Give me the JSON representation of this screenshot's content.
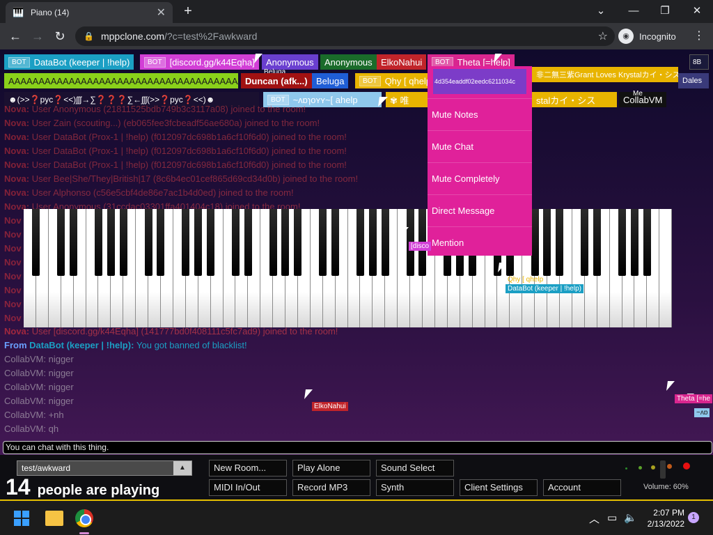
{
  "browser": {
    "tab_title": "Piano (14)",
    "tab_favicon": "piano-icon",
    "url_host": "mppclone.com",
    "url_path": "/?c=test%2Fawkward",
    "incognito_label": "Incognito"
  },
  "users_row1": [
    {
      "label": "DataBot (keeper | !help)",
      "bot": true,
      "color": "#1b9fc4"
    },
    {
      "label": "[discord.gg/k44Eqha]",
      "bot": true,
      "color": "#d23fd6"
    },
    {
      "label": "Anonymous",
      "bot": false,
      "color": "#6a3fd0"
    },
    {
      "label": "Anonymous",
      "bot": false,
      "color": "#1a6b2a"
    },
    {
      "label": "ElkoNahui",
      "bot": false,
      "color": "#c1242a"
    },
    {
      "label": "Theta [=help]",
      "bot": true,
      "color": "#d9268f"
    }
  ],
  "users_row2": [
    {
      "label": "AAAAAAAAAAAAAAAAAAAAAAAAAAAAAAAAAAAAAAAAAAA",
      "bot": false,
      "color": "#8ad11a"
    },
    {
      "label": "Duncan (afk...)",
      "bot": false,
      "color": "#a11212"
    },
    {
      "label": "Beluga",
      "bot": false,
      "color": "#1f5ed6"
    },
    {
      "label": "Qhy [ qhelp",
      "bot": true,
      "color": "#e8b400"
    },
    {
      "label": "非二無三紫Grant Loves Krystalカイ・シス",
      "bot": false,
      "color": "#e8b400"
    },
    {
      "label": "Dales",
      "bot": false,
      "color": "#3a3a7a"
    }
  ],
  "users_row3": [
    {
      "label": "☻(>>❓pyc❓<<)ʃʃʃ→∑❓❓❓∑←ʃʃʃ(>>❓pyc❓<<)☻",
      "bot": false,
      "color": "#1a1030"
    },
    {
      "label": "~ʌɒɿoʏʏ~[ ahelp",
      "bot": true,
      "color": "#8fc8ec"
    },
    {
      "label": "stalカイ・シス",
      "bot": false,
      "color": "#e8b400"
    },
    {
      "label": "CollabVM",
      "bot": false,
      "color": "#111"
    }
  ],
  "small_tags": {
    "beluga": "Beluga",
    "me": "Me",
    "corner": "8B"
  },
  "chat_system": [
    {
      "who": "Nova:",
      "msg": "User Anonymous (21811525bdb749b3c3117a08) joined to the room!"
    },
    {
      "who": "Nova:",
      "msg": "User Zain (scouting...) (eb065fee3fcbeadf56ae680a) joined to the room!"
    },
    {
      "who": "Nova:",
      "msg": "User DataBot (Prox-1 | !help) (f012097dc698b1a6cf10f6d0) joined to the room!"
    },
    {
      "who": "Nova:",
      "msg": "User DataBot (Prox-1 | !help) (f012097dc698b1a6cf10f6d0) joined to the room!"
    },
    {
      "who": "Nova:",
      "msg": "User DataBot (Prox-1 | !help) (f012097dc698b1a6cf10f6d0) joined to the room!"
    },
    {
      "who": "Nova:",
      "msg": "User Bee|She/They|British|17 (8c6b4ec01cef865d69cd34d0b) joined to the room!"
    },
    {
      "who": "Nova:",
      "msg": "User Alphonso (c56e5cbf4de86e7ac1b4d0ed) joined to the room!"
    },
    {
      "who": "Nova:",
      "msg": "User Anonymous (31ccdac03301ffa401404c18) joined to the room!"
    },
    {
      "who": "Nov",
      "msg": ""
    },
    {
      "who": "Nov",
      "msg": ""
    },
    {
      "who": "Nov",
      "msg": ""
    },
    {
      "who": "Nov",
      "msg": ""
    },
    {
      "who": "Nov",
      "msg": ""
    },
    {
      "who": "Nov",
      "msg": ""
    },
    {
      "who": "Nov",
      "msg": ""
    },
    {
      "who": "Nov",
      "msg": ""
    }
  ],
  "chat_last_system": {
    "who": "Nova:",
    "msg": "User [discord.gg/k44Eqha] (141777bd0f408111c5fc7ad9) joined to the room!"
  },
  "chat_from": {
    "prefix": "From",
    "who": "DataBot (keeper | !help):",
    "msg": "You got banned of blacklist!"
  },
  "chat_collab": [
    {
      "who": "CollabVM:",
      "msg": "nigger"
    },
    {
      "who": "CollabVM:",
      "msg": "nigger"
    },
    {
      "who": "CollabVM:",
      "msg": "nigger"
    },
    {
      "who": "CollabVM:",
      "msg": "nigger"
    },
    {
      "who": "CollabVM:",
      "msg": "+nh"
    },
    {
      "who": "CollabVM:",
      "msg": "qh"
    }
  ],
  "context_menu": {
    "id": "4d354eaddf02eedc6211034c",
    "items": [
      "Mute Notes",
      "Mute Chat",
      "Mute Completely",
      "Direct Message",
      "Mention"
    ]
  },
  "cursor_tags": {
    "discord": "[disco",
    "qhy": "Qhy [ qhelp",
    "databot": "DataBot (keeper | !help)",
    "elko": "ElkoNahui",
    "theta": "Theta [=he",
    "vavo": "~ʌɒ"
  },
  "chat_input_placeholder": "You can chat with this thing.",
  "room_name": "test/awkward",
  "people_count": "14",
  "people_text": "people are playing",
  "buttons": {
    "new_room": "New Room...",
    "play_alone": "Play Alone",
    "sound_select": "Sound Select",
    "midi": "MIDI In/Out",
    "record": "Record MP3",
    "synth": "Synth",
    "client_settings": "Client Settings",
    "account": "Account"
  },
  "volume_label": "Volume: 60%",
  "taskbar": {
    "time": "2:07 PM",
    "date": "2/13/2022",
    "notif_count": "1"
  }
}
